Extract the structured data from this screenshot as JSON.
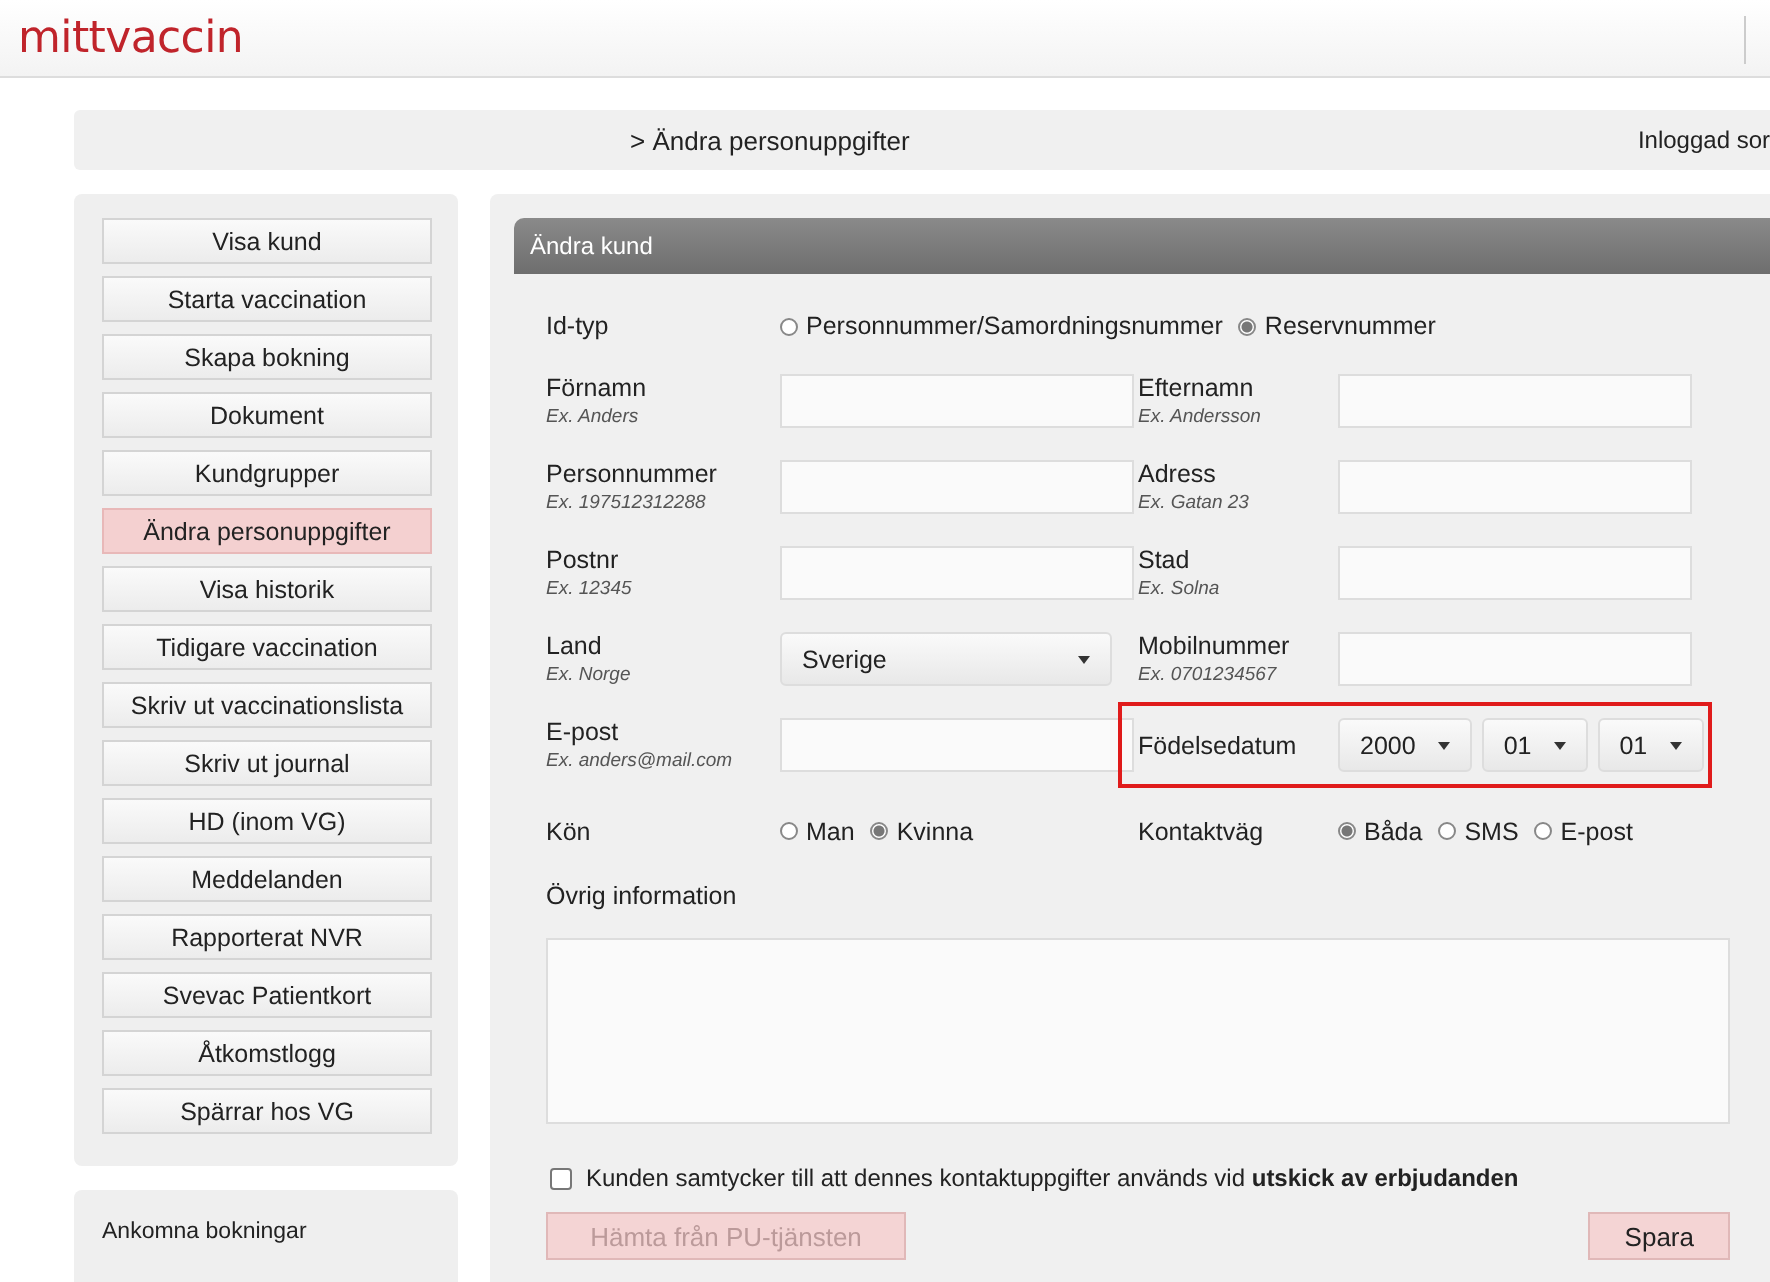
{
  "logo": "mittvaccin",
  "breadcrumb": "> Ändra personuppgifter",
  "logged_in": "Inloggad sor",
  "sidebar": {
    "items": [
      {
        "label": "Visa kund",
        "selected": false
      },
      {
        "label": "Starta vaccination",
        "selected": false
      },
      {
        "label": "Skapa bokning",
        "selected": false
      },
      {
        "label": "Dokument",
        "selected": false
      },
      {
        "label": "Kundgrupper",
        "selected": false
      },
      {
        "label": "Ändra personuppgifter",
        "selected": true
      },
      {
        "label": "Visa historik",
        "selected": false
      },
      {
        "label": "Tidigare vaccination",
        "selected": false
      },
      {
        "label": "Skriv ut vaccinationslista",
        "selected": false
      },
      {
        "label": "Skriv ut journal",
        "selected": false
      },
      {
        "label": "HD (inom VG)",
        "selected": false
      },
      {
        "label": "Meddelanden",
        "selected": false
      },
      {
        "label": "Rapporterat NVR",
        "selected": false
      },
      {
        "label": "Svevac Patientkort",
        "selected": false
      },
      {
        "label": "Åtkomstlogg",
        "selected": false
      },
      {
        "label": "Spärrar hos VG",
        "selected": false
      }
    ]
  },
  "bookings_panel": {
    "title": "Ankomna bokningar"
  },
  "form": {
    "title": "Ändra kund",
    "id_type": {
      "label": "Id-typ",
      "options": [
        {
          "label": "Personnummer/Samordningsnummer",
          "selected": false
        },
        {
          "label": "Reservnummer",
          "selected": true
        }
      ]
    },
    "fields": [
      {
        "kind": "text",
        "label": "Förnamn",
        "hint": "Ex. Anders"
      },
      {
        "kind": "text",
        "label": "Efternamn",
        "hint": "Ex. Andersson"
      },
      {
        "kind": "text",
        "label": "Personnummer",
        "hint": "Ex. 197512312288"
      },
      {
        "kind": "text",
        "label": "Adress",
        "hint": "Ex. Gatan 23"
      },
      {
        "kind": "text",
        "label": "Postnr",
        "hint": "Ex. 12345"
      },
      {
        "kind": "text",
        "label": "Stad",
        "hint": "Ex. Solna"
      },
      {
        "kind": "select",
        "label": "Land",
        "hint": "Ex. Norge",
        "value": "Sverige"
      },
      {
        "kind": "text",
        "label": "Mobilnummer",
        "hint": "Ex. 0701234567"
      },
      {
        "kind": "text",
        "label": "E-post",
        "hint": "Ex. anders@mail.com"
      },
      {
        "kind": "date",
        "label": "Födelsedatum",
        "highlighted": true,
        "parts": [
          "2000",
          "01",
          "01"
        ]
      },
      {
        "kind": "radio",
        "label": "Kön",
        "options": [
          {
            "label": "Man",
            "selected": false
          },
          {
            "label": "Kvinna",
            "selected": true
          }
        ]
      },
      {
        "kind": "radio",
        "label": "Kontaktväg",
        "options": [
          {
            "label": "Båda",
            "selected": true
          },
          {
            "label": "SMS",
            "selected": false
          },
          {
            "label": "E-post",
            "selected": false
          }
        ]
      }
    ],
    "notes": {
      "label": "Övrig information"
    },
    "consent": {
      "checked": false,
      "text": "Kunden samtycker till att dennes kontaktuppgifter används vid **utskick av erbjudanden**"
    },
    "buttons": [
      {
        "label": "Hämta från PU-tjänsten",
        "disabled": true
      },
      {
        "label": "Spara",
        "disabled": false
      }
    ]
  }
}
